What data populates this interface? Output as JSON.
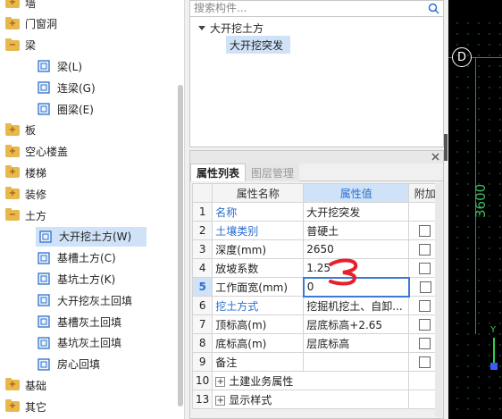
{
  "tree": {
    "items": [
      {
        "label": "墙",
        "type": "folder"
      },
      {
        "label": "门窗洞",
        "type": "folder"
      },
      {
        "label": "梁",
        "type": "folder-open"
      },
      {
        "label": "梁(L)",
        "type": "child"
      },
      {
        "label": "连梁(G)",
        "type": "child"
      },
      {
        "label": "圈梁(E)",
        "type": "child"
      },
      {
        "label": "板",
        "type": "folder"
      },
      {
        "label": "空心楼盖",
        "type": "folder"
      },
      {
        "label": "楼梯",
        "type": "folder"
      },
      {
        "label": "装修",
        "type": "folder"
      },
      {
        "label": "土方",
        "type": "folder-open"
      },
      {
        "label": "大开挖土方(W)",
        "type": "child",
        "selected": true
      },
      {
        "label": "基槽土方(C)",
        "type": "child"
      },
      {
        "label": "基坑土方(K)",
        "type": "child"
      },
      {
        "label": "大开挖灰土回填",
        "type": "child"
      },
      {
        "label": "基槽灰土回填",
        "type": "child"
      },
      {
        "label": "基坑灰土回填",
        "type": "child"
      },
      {
        "label": "房心回填",
        "type": "child"
      },
      {
        "label": "基础",
        "type": "folder"
      },
      {
        "label": "其它",
        "type": "folder"
      }
    ]
  },
  "search": {
    "placeholder": "搜索构件..."
  },
  "components": {
    "parent": "大开挖土方",
    "child": "大开挖突发"
  },
  "properties": {
    "tabs": [
      "属性列表",
      "图层管理"
    ],
    "headers": [
      "属性名称",
      "属性值",
      "附加"
    ],
    "rows": [
      {
        "index": "1",
        "name": "名称",
        "value": "大开挖突发",
        "blue": true,
        "check": false
      },
      {
        "index": "2",
        "name": "土壤类别",
        "value": "普硬土",
        "blue": true,
        "check": true
      },
      {
        "index": "3",
        "name": "深度(mm)",
        "value": "2650",
        "blue": false,
        "check": true
      },
      {
        "index": "4",
        "name": "放坡系数",
        "value": "1.25",
        "blue": false,
        "check": true
      },
      {
        "index": "5",
        "name": "工作面宽(mm)",
        "value": "0",
        "blue": false,
        "check": true,
        "editing": true
      },
      {
        "index": "6",
        "name": "挖土方式",
        "value": "挖掘机挖土、自卸...",
        "blue": true,
        "check": true
      },
      {
        "index": "7",
        "name": "顶标高(m)",
        "value": "层底标高+2.65",
        "blue": false,
        "check": true
      },
      {
        "index": "8",
        "name": "底标高(m)",
        "value": "层底标高",
        "blue": false,
        "check": true
      },
      {
        "index": "9",
        "name": "备注",
        "value": "",
        "blue": false,
        "check": true
      },
      {
        "index": "10",
        "name": "土建业务属性",
        "value": "",
        "group": true
      },
      {
        "index": "13",
        "name": "显示样式",
        "value": "",
        "group": true
      }
    ]
  },
  "canvas": {
    "axis_label": "D",
    "dimension": "3600",
    "axis_y": "Y"
  },
  "colors": {
    "accent_blue": "#2a6fcf",
    "selection": "#cfe2f7",
    "annotation_red": "#e8202a",
    "cad_green": "#2f8f4f"
  }
}
